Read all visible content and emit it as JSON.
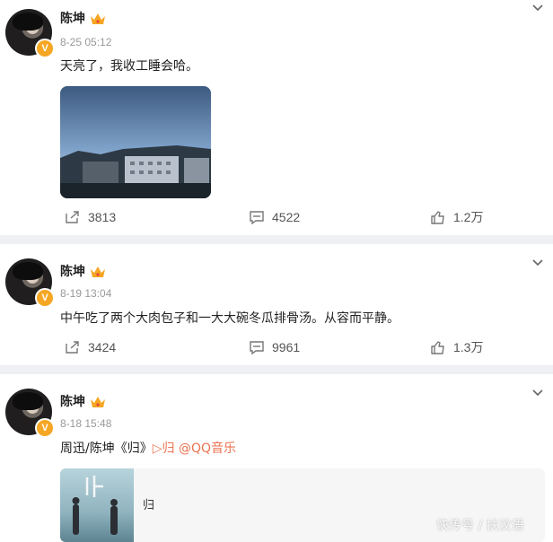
{
  "posts": [
    {
      "author": "陈坤",
      "time": "8-25 05:12",
      "text": "天亮了，我收工睡会哈。",
      "repost_count": "3813",
      "comment_count": "4522",
      "like_count": "1.2万"
    },
    {
      "author": "陈坤",
      "time": "8-19 13:04",
      "text": "中午吃了两个大肉包子和一大大碗冬瓜排骨汤。从容而平静。",
      "repost_count": "3424",
      "comment_count": "9961",
      "like_count": "1.3万"
    },
    {
      "author": "陈坤",
      "time": "8-18 15:48",
      "text_prefix": "周迅/陈坤《归》",
      "music_link": "▷归",
      "mention": "@QQ音乐",
      "card_title": "归"
    }
  ],
  "watermark": "快传号 / 扶汶语",
  "colors": {
    "accent_orange": "#eb7350",
    "verified_badge": "#f5a623",
    "separator": "#eef0f3"
  },
  "icons": [
    "avatar",
    "crown-icon",
    "verified-badge-icon",
    "chevron-down-icon",
    "repost-icon",
    "comment-icon",
    "like-icon"
  ]
}
